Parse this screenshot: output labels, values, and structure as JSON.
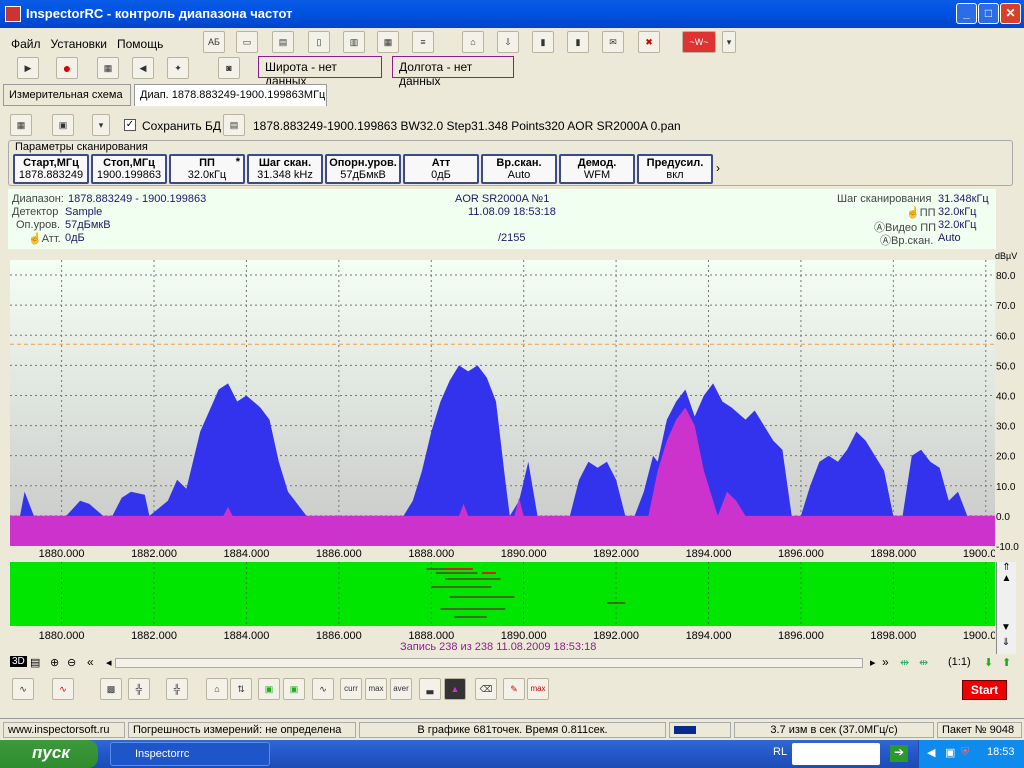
{
  "app": {
    "title": "InspectorRC - контроль диапазона частот"
  },
  "menu": {
    "file": "Файл",
    "settings": "Установки",
    "help": "Помощь"
  },
  "coords": {
    "lat": "Широта - нет данных",
    "lon": "Долгота - нет данных"
  },
  "tabs": {
    "scheme": "Измерительная схема",
    "range": "Диап. 1878.883249-1900.199863МГц"
  },
  "scan": {
    "save_db": "Сохранить БД",
    "description": "1878.883249-1900.199863 BW32.0 Step31.348 Points320 AOR SR2000A 0.pan"
  },
  "params": {
    "legend": "Параметры сканирования",
    "items": [
      {
        "label": "Старт,МГц",
        "value": "1878.883249"
      },
      {
        "label": "Стоп,МГц",
        "value": "1900.199863"
      },
      {
        "label": "ПП",
        "value": "32.0кГц",
        "mark": "*"
      },
      {
        "label": "Шаг скан.",
        "value": "31.348 kHz"
      },
      {
        "label": "Опорн.уров.",
        "value": "57дБмкВ"
      },
      {
        "label": "Атт",
        "value": "0дБ"
      },
      {
        "label": "Вр.скан.",
        "value": "Auto"
      },
      {
        "label": "Демод.",
        "value": "WFM"
      },
      {
        "label": "Предусил.",
        "value": "вкл"
      }
    ]
  },
  "info": {
    "range_label": "Диапазон:",
    "range_value": "1878.883249 - 1900.199863",
    "detector_label": "Детектор",
    "detector_value": "Sample",
    "ref_label": "Оп.уров.",
    "ref_value": "57дБмкВ",
    "att_label": "Атт.",
    "att_value": "0дБ",
    "device": "AOR SR2000A №1",
    "datetime": "11.08.09 18:53:18",
    "count": "/2155",
    "step_label": "Шаг сканирования",
    "step_value": "31.348кГц",
    "bw_label": "ПП",
    "bw_value": "32.0кГц",
    "vbw_label": "Видео ПП",
    "vbw_value": "32.0кГц",
    "sweep_label": "Вр.скан.",
    "sweep_value": "Auto"
  },
  "chart_data": {
    "type": "area",
    "ylabel": "dBµV",
    "xlim": [
      1878.883249,
      1900.199863
    ],
    "ylim": [
      -10,
      85
    ],
    "xticks": [
      1880,
      1882,
      1884,
      1886,
      1888,
      1890,
      1892,
      1894,
      1896,
      1898,
      1900
    ],
    "xtick_labels": [
      "1880.000",
      "1882.000",
      "1884.000",
      "1886.000",
      "1888.000",
      "1890.000",
      "1892.000",
      "1894.000",
      "1896.000",
      "1898.000",
      "1900.000"
    ],
    "yticks": [
      80,
      70,
      60,
      50,
      40,
      30,
      20,
      10,
      0,
      -10
    ],
    "ytick_labels": [
      "80.0",
      "70.0",
      "60.0",
      "50.0",
      "40.0",
      "30.0",
      "20.0",
      "10.0",
      "0.0",
      "-10.0"
    ],
    "threshold": 57,
    "series": [
      {
        "color": "#3333ee",
        "x": [
          1878.883,
          1879.1,
          1879.2,
          1879.4,
          1879.6,
          1880.1,
          1880.4,
          1880.6,
          1880.9,
          1881.1,
          1881.3,
          1881.5,
          1881.8,
          1881.9,
          1882.3,
          1882.5,
          1882.7,
          1883.0,
          1883.2,
          1883.4,
          1883.6,
          1883.8,
          1884.0,
          1884.3,
          1884.5,
          1884.7,
          1884.9,
          1885.1,
          1885.3,
          1885.6,
          1886.0,
          1886.5,
          1887.0,
          1887.4,
          1887.6,
          1887.8,
          1888.0,
          1888.2,
          1888.4,
          1888.6,
          1888.8,
          1889.0,
          1889.2,
          1889.4,
          1889.6,
          1889.7,
          1889.9,
          1890.1,
          1890.3,
          1890.6,
          1890.8,
          1891.0,
          1891.2,
          1891.4,
          1891.6,
          1891.8,
          1892.0,
          1892.2,
          1892.4,
          1892.6,
          1892.8,
          1892.9,
          1893.1,
          1893.3,
          1893.5,
          1893.7,
          1893.9,
          1894.1,
          1894.3,
          1894.5,
          1894.8,
          1895.0,
          1895.2,
          1895.4,
          1895.6,
          1895.8,
          1896.0,
          1896.2,
          1896.4,
          1896.6,
          1896.8,
          1897.0,
          1897.2,
          1897.4,
          1897.6,
          1897.8,
          1898.0,
          1898.2,
          1898.4,
          1898.6,
          1898.8,
          1899.0,
          1899.2,
          1899.4,
          1899.6,
          1899.8,
          1900.0,
          1900.199
        ],
        "y": [
          0,
          0,
          8,
          0,
          0,
          0,
          5,
          4,
          0,
          0,
          6,
          8,
          7,
          0,
          5,
          12,
          9,
          28,
          35,
          42,
          44,
          38,
          40,
          36,
          32,
          18,
          8,
          4,
          0,
          0,
          0,
          0,
          0,
          0,
          5,
          15,
          28,
          38,
          45,
          50,
          48,
          50,
          46,
          38,
          12,
          0,
          5,
          18,
          0,
          0,
          0,
          0,
          12,
          18,
          16,
          18,
          12,
          0,
          0,
          8,
          20,
          18,
          32,
          38,
          42,
          33,
          40,
          44,
          38,
          36,
          32,
          35,
          30,
          25,
          22,
          0,
          0,
          10,
          18,
          20,
          18,
          22,
          28,
          25,
          20,
          15,
          0,
          0,
          20,
          22,
          18,
          16,
          5,
          8,
          0,
          0,
          0,
          0
        ]
      },
      {
        "color": "#cc33cc",
        "x": [
          1878.883,
          1883.5,
          1883.6,
          1883.7,
          1888.6,
          1888.7,
          1888.8,
          1889.8,
          1889.9,
          1890.0,
          1892.7,
          1892.9,
          1893.1,
          1893.3,
          1893.5,
          1893.7,
          1893.9,
          1894.2,
          1894.4,
          1894.6,
          1894.8,
          1900.199
        ],
        "y": [
          0,
          0,
          3,
          0,
          0,
          4,
          0,
          0,
          6,
          0,
          0,
          15,
          25,
          32,
          36,
          30,
          15,
          0,
          8,
          5,
          0,
          0
        ]
      }
    ]
  },
  "waterfall": {
    "record": "Запись 238  из 238   11.08.2009 18:53:18"
  },
  "nav": {
    "zoom": "(1:1)"
  },
  "toolbar": {
    "start": "Start"
  },
  "status": {
    "site": "www.inspectorsoft.ru",
    "error": "Погрешность измерений: не определена",
    "points": "В графике 681точек. Время 0.811сек.",
    "rate": "3.7 изм в сек (37.0МГц/с)",
    "packet": "Пакет № 9048"
  },
  "taskbar": {
    "start": "пуск",
    "task": "Inspectorrc",
    "lang": "RL",
    "clock": "18:53"
  }
}
